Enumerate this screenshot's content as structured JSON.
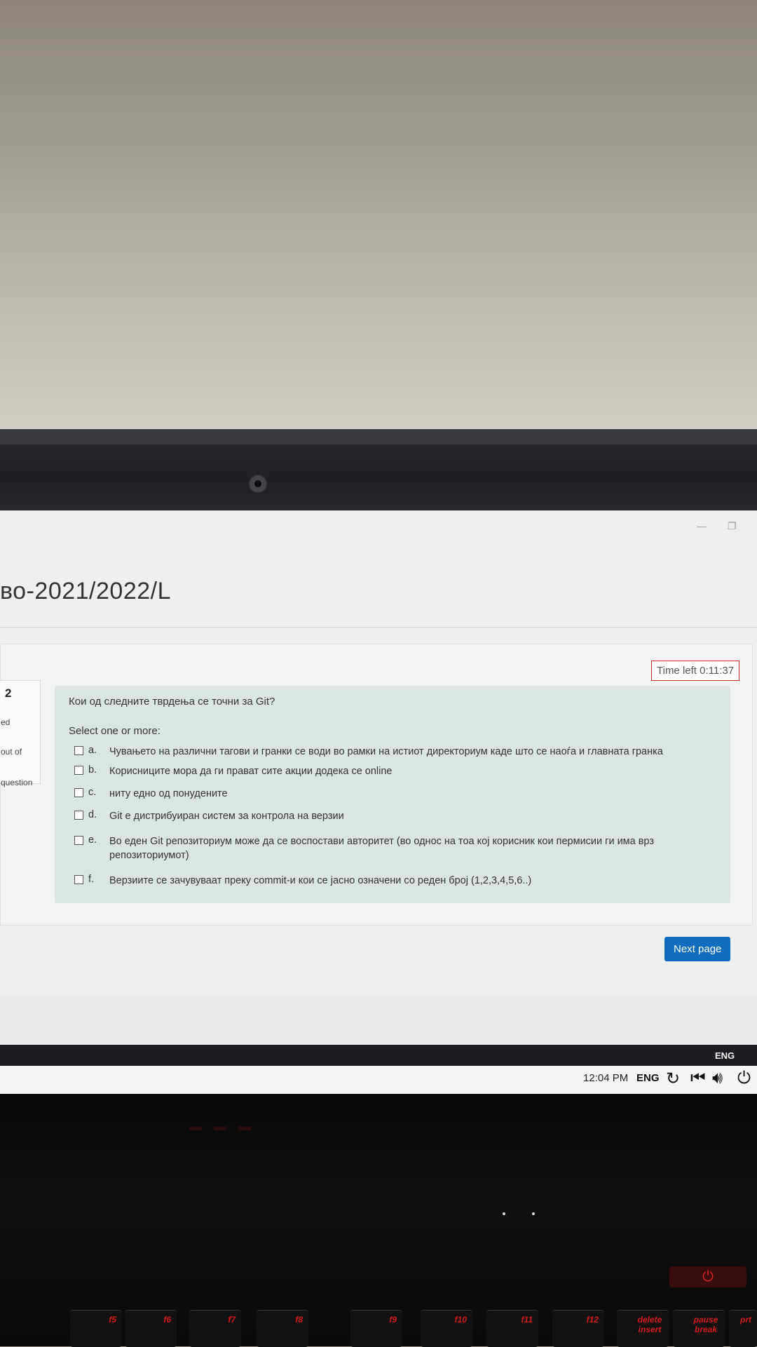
{
  "page": {
    "course_title": "во-2021/2022/L",
    "timer": "Time left 0:11:37"
  },
  "question_info": {
    "number": "2",
    "line1": "ed",
    "line2": "out of",
    "line3": "question"
  },
  "question": {
    "text": "Кои од следните тврдења се точни за Git?",
    "prompt": "Select one or more:",
    "options": [
      {
        "letter": "a.",
        "text": "Чувањето на различни тагови и гранки се води во рамки на истиот директориум каде што се наоѓа и главната гранка"
      },
      {
        "letter": "b.",
        "text": "Корисниците мора да ги прават сите акции додека се online"
      },
      {
        "letter": "c.",
        "text": "ниту едно од понудените"
      },
      {
        "letter": "d.",
        "text": "Git е дистрибуиран систем за контрола на верзии"
      },
      {
        "letter": "e.",
        "text": "Во еден Git репозиториум може да се воспостави авторитет (во однос на тоа кој корисник кои пермисии ги има врз репозиториумот)"
      },
      {
        "letter": "f.",
        "text": "Верзиите се зачувуваат преку commit-и кои се јасно означени со реден број (1,2,3,4,5,6..)"
      }
    ]
  },
  "actions": {
    "next_page": "Next page"
  },
  "taskbar": {
    "lang_top": "ENG",
    "time": "12:04 PM",
    "lang": "ENG",
    "icons": [
      "refresh-icon",
      "skip-back-icon",
      "volume-icon",
      "power-icon"
    ]
  },
  "keyboard": {
    "keys": [
      "f5",
      "f6",
      "f7",
      "f8",
      "f9",
      "f10",
      "f11",
      "f12",
      "delete insert",
      "pause break",
      "prt"
    ]
  },
  "colors": {
    "timer_border": "#c9302c",
    "button_bg": "#0f6cbf",
    "question_bg": "#dde4e4",
    "key_label": "#d31b1b"
  }
}
